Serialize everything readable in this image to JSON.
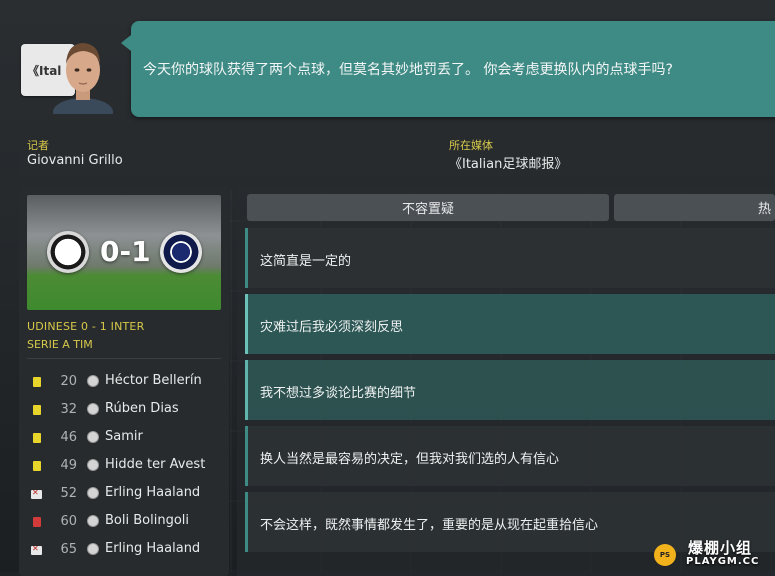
{
  "header": {
    "media_logo_text": "《Ital",
    "question": "今天你的球队获得了两个点球，但莫名其妙地罚丢了。 你会考虑更换队内的点球手吗?"
  },
  "reporter": {
    "label": "记者",
    "name": "Giovanni Grillo",
    "media_label": "所在媒体",
    "media_name": "《Italian足球邮报》"
  },
  "match": {
    "score": "0-1",
    "title": "UDINESE 0 - 1 INTER",
    "competition": "SERIE A TIM",
    "events": [
      {
        "type": "yellow",
        "minute": "20",
        "player": "Héctor Bellerín"
      },
      {
        "type": "yellow",
        "minute": "32",
        "player": "Rúben Dias"
      },
      {
        "type": "yellow",
        "minute": "46",
        "player": "Samir"
      },
      {
        "type": "yellow",
        "minute": "49",
        "player": "Hidde ter Avest"
      },
      {
        "type": "sub",
        "minute": "52",
        "player": "Erling Haaland"
      },
      {
        "type": "red",
        "minute": "60",
        "player": "Boli Bolingoli"
      },
      {
        "type": "sub",
        "minute": "65",
        "player": "Erling Haaland"
      }
    ]
  },
  "tabs": [
    {
      "label": "不容置疑"
    },
    {
      "label": "热"
    }
  ],
  "answers": [
    {
      "text": "这简直是一定的"
    },
    {
      "text": "灾难过后我必须深刻反思"
    },
    {
      "text": "我不想过多谈论比赛的细节"
    },
    {
      "text": "换人当然是最容易的决定，但我对我们选的人有信心"
    },
    {
      "text": "不会这样，既然事情都发生了，重要的是从现在起重拾信心"
    }
  ],
  "watermark": {
    "badge": "PS",
    "cn": "爆棚小组",
    "en": "PLAYGM.CC"
  },
  "colors": {
    "accent_teal": "#3e8a84",
    "label_yellow": "#d7c94a",
    "panel": "#272b2e"
  }
}
